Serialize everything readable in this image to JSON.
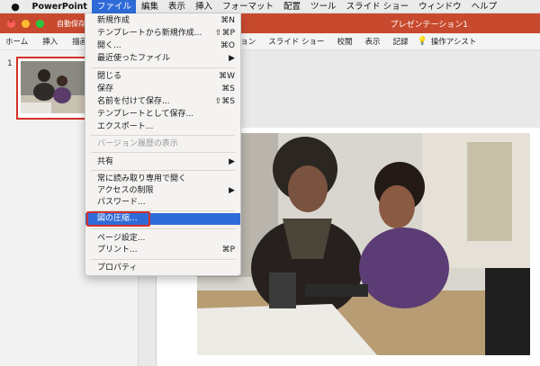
{
  "menubar": {
    "app": "PowerPoint",
    "items": [
      "ファイル",
      "編集",
      "表示",
      "挿入",
      "フォーマット",
      "配置",
      "ツール",
      "スライド ショー",
      "ウィンドウ",
      "ヘルプ"
    ]
  },
  "titlebar": {
    "autosave": "自動保存",
    "doc_title": "プレゼンテーション1"
  },
  "ribbon": {
    "tabs_left": [
      "ホーム",
      "挿入",
      "描画"
    ],
    "tabs_right": [
      "ョン",
      "スライド ショー",
      "校閲",
      "表示",
      "記録"
    ],
    "assist": "操作アシスト"
  },
  "slides": {
    "number": "1"
  },
  "file_menu": {
    "items": [
      {
        "label": "新規作成",
        "shortcut": "⌘N"
      },
      {
        "label": "テンプレートから新規作成...",
        "shortcut": "⇧⌘P"
      },
      {
        "label": "開く...",
        "shortcut": "⌘O"
      },
      {
        "label": "最近使ったファイル",
        "shortcut": "▶"
      },
      {
        "label": "閉じる",
        "shortcut": "⌘W"
      },
      {
        "label": "保存",
        "shortcut": "⌘S"
      },
      {
        "label": "名前を付けて保存...",
        "shortcut": "⇧⌘S"
      },
      {
        "label": "テンプレートとして保存...",
        "shortcut": ""
      },
      {
        "label": "エクスポート...",
        "shortcut": ""
      },
      {
        "label": "バージョン履歴の表示",
        "shortcut": ""
      },
      {
        "label": "共有",
        "shortcut": "▶"
      },
      {
        "label": "常に読み取り専用で開く",
        "shortcut": ""
      },
      {
        "label": "アクセスの制限",
        "shortcut": "▶"
      },
      {
        "label": "パスワード...",
        "shortcut": ""
      },
      {
        "label": "図の圧縮...",
        "shortcut": ""
      },
      {
        "label": "ページ設定...",
        "shortcut": ""
      },
      {
        "label": "プリント...",
        "shortcut": "⌘P"
      },
      {
        "label": "プロパティ",
        "shortcut": ""
      }
    ]
  },
  "colors": {
    "titlebar": "#c84a2e",
    "menu_highlight": "#2f6bd8",
    "callout_border": "#d0332c"
  }
}
